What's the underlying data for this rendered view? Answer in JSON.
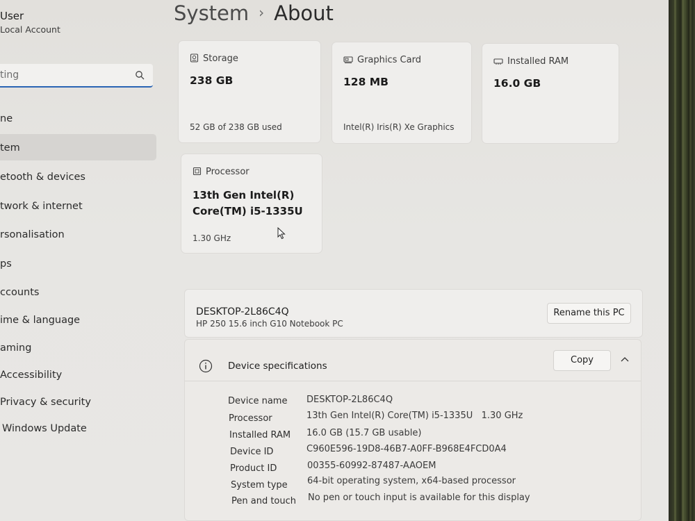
{
  "sidebar": {
    "user_name": "User",
    "user_sub": "Local Account",
    "search_placeholder": "ting",
    "items": [
      {
        "label": "ne"
      },
      {
        "label": "tem"
      },
      {
        "label": "etooth & devices"
      },
      {
        "label": "twork & internet"
      },
      {
        "label": "rsonalisation"
      },
      {
        "label": "ps"
      },
      {
        "label": "ccounts"
      },
      {
        "label": "ime & language"
      },
      {
        "label": "aming"
      },
      {
        "label": "Accessibility"
      },
      {
        "label": "Privacy & security"
      },
      {
        "label": "Windows Update"
      }
    ],
    "active_index": 1
  },
  "header": {
    "crumb": "System",
    "title": "About"
  },
  "cards": {
    "storage": {
      "label": "Storage",
      "value": "238 GB",
      "detail": "52 GB of 238 GB used",
      "icon": "storage-icon"
    },
    "graphics": {
      "label": "Graphics Card",
      "value": "128 MB",
      "detail": "Intel(R) Iris(R) Xe Graphics",
      "icon": "graphics-card-icon"
    },
    "ram": {
      "label": "Installed RAM",
      "value": "16.0 GB",
      "icon": "ram-icon"
    },
    "processor": {
      "label": "Processor",
      "value_line1": "13th Gen Intel(R)",
      "value_line2": "Core(TM) i5-1335U",
      "detail": "1.30 GHz",
      "icon": "processor-icon"
    }
  },
  "pc": {
    "name": "DESKTOP-2L86C4Q",
    "model": "HP 250 15.6 inch G10 Notebook PC",
    "rename_label": "Rename this PC"
  },
  "specs": {
    "title": "Device specifications",
    "copy_label": "Copy",
    "rows": [
      {
        "label": "Device name",
        "value": "DESKTOP-2L86C4Q"
      },
      {
        "label": "Processor",
        "value": "13th Gen Intel(R) Core(TM) i5-1335U   1.30 GHz"
      },
      {
        "label": "Installed RAM",
        "value": "16.0 GB (15.7 GB usable)"
      },
      {
        "label": "Device ID",
        "value": "C960E596-19D8-46B7-A0FF-B968E4FCD0A4"
      },
      {
        "label": "Product ID",
        "value": "00355-60992-87487-AAOEM"
      },
      {
        "label": "System type",
        "value": "64-bit operating system, x64-based processor"
      },
      {
        "label": "Pen and touch",
        "value": "No pen or touch input is available for this display"
      }
    ]
  },
  "colors": {
    "accent": "#2a64b4",
    "card_bg": "#efeeec",
    "page_bg": "#e5e4e1"
  }
}
